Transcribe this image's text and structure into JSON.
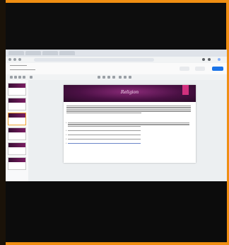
{
  "slide": {
    "title": "Religion"
  },
  "colors": {
    "frame_border": "#ef8e12",
    "slide_banner": "#5b1750",
    "accent_pink": "#d1307e",
    "share_button": "#1a73e8"
  },
  "icons": {
    "filmstrip": "slide-thumbnail",
    "toolbar": "toolbar-tool-icon"
  }
}
